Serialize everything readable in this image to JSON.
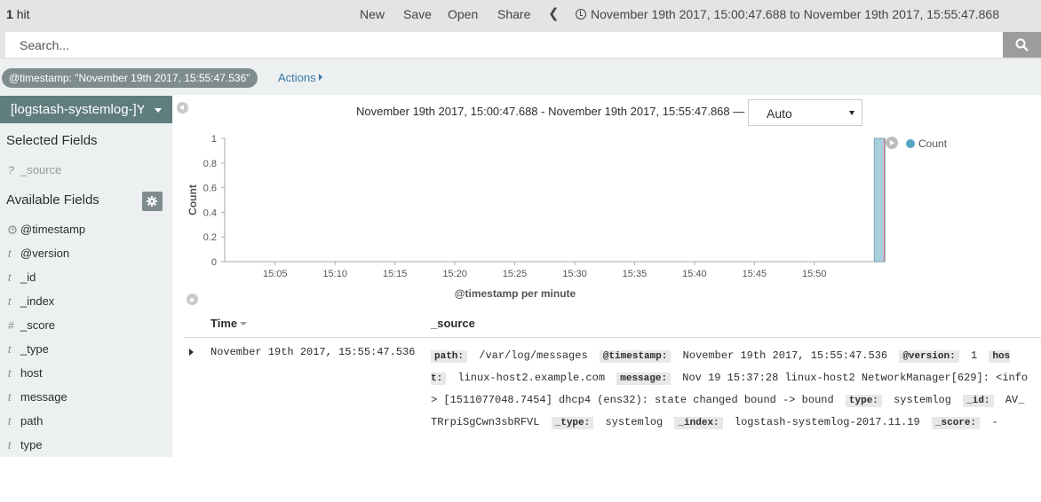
{
  "topbar": {
    "hit_count": "1",
    "hit_label": "hit",
    "menu": {
      "new": "New",
      "save": "Save",
      "open": "Open",
      "share": "Share"
    },
    "back_glyph": "❮",
    "time_range": "November 19th 2017, 15:00:47.688 to November 19th 2017, 15:55:47.868"
  },
  "search": {
    "placeholder": "Search...",
    "icon": "search-icon"
  },
  "filterbar": {
    "filter": "@timestamp: \"November 19th 2017, 15:55:47.536\"",
    "actions": "Actions"
  },
  "sidebar": {
    "index_pattern": "[logstash-systemlog-]YYYY.MM.DD",
    "selected_title": "Selected Fields",
    "selected_fields": [
      {
        "type": "?",
        "name": "_source"
      }
    ],
    "available_title": "Available Fields",
    "available_fields": [
      {
        "type": "clock",
        "name": "@timestamp"
      },
      {
        "type": "t",
        "name": "@version"
      },
      {
        "type": "t",
        "name": "_id"
      },
      {
        "type": "t",
        "name": "_index"
      },
      {
        "type": "#",
        "name": "_score"
      },
      {
        "type": "t",
        "name": "_type"
      },
      {
        "type": "t",
        "name": "host"
      },
      {
        "type": "t",
        "name": "message"
      },
      {
        "type": "t",
        "name": "path"
      },
      {
        "type": "t",
        "name": "type"
      }
    ]
  },
  "chart_header": {
    "range": "November 19th 2017, 15:00:47.688 - November 19th 2017, 15:55:47.868 —",
    "interval": "Auto"
  },
  "colors": {
    "bar_fill": "#a8cfdd",
    "bar_stroke": "#6d9bb0",
    "legend_dot": "#57a3c4",
    "sidebar_bg": "#ecf0f1",
    "index_bg": "#5f7d7e",
    "link": "#3a7aa6"
  },
  "chart_data": {
    "type": "bar",
    "xlabel": "@timestamp per minute",
    "ylabel": "Count",
    "ylim": [
      0,
      1
    ],
    "yticks": [
      "0",
      "0.2",
      "0.4",
      "0.6",
      "0.8",
      "1"
    ],
    "xticks": [
      "15:05",
      "15:10",
      "15:15",
      "15:20",
      "15:25",
      "15:30",
      "15:35",
      "15:40",
      "15:45",
      "15:50"
    ],
    "x_range_minutes": [
      "15:00:47.688",
      "15:55:47.868"
    ],
    "series": [
      {
        "name": "Count",
        "bars": [
          {
            "x": "15:55",
            "value": 1
          }
        ]
      }
    ],
    "legend": "top-right"
  },
  "table": {
    "columns": {
      "time": "Time",
      "source": "_source"
    },
    "rows": [
      {
        "time": "November 19th 2017, 15:55:47.536",
        "source": [
          {
            "k": "path:",
            "v": "/var/log/messages"
          },
          {
            "k": "@timestamp:",
            "v": "November 19th 2017, 15:55:47.536"
          },
          {
            "k": "@version:",
            "v": "1"
          },
          {
            "k": "host:",
            "v": "linux-host2.example.com"
          },
          {
            "k": "message:",
            "v": "Nov 19 15:37:28 linux-host2 NetworkManager[629]: <info> [1511077048.7454] dhcp4 (ens32): state changed bound -> bound"
          },
          {
            "k": "type:",
            "v": "systemlog"
          },
          {
            "k": "_id:",
            "v": "AV_TRrpiSgCwn3sbRFVL"
          },
          {
            "k": "_type:",
            "v": "systemlog"
          },
          {
            "k": "_index:",
            "v": "logstash-systemlog-2017.11.19"
          },
          {
            "k": "_score:",
            "v": " -"
          }
        ]
      }
    ]
  }
}
